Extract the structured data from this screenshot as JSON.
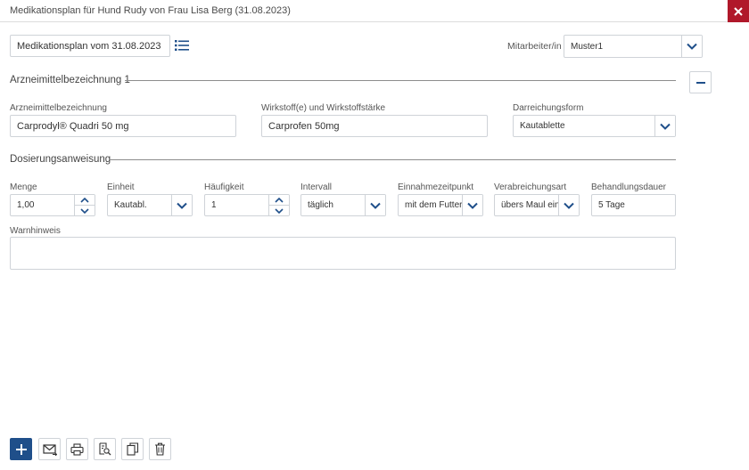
{
  "window": {
    "title": "Medikationsplan für Hund Rudy von Frau Lisa Berg (31.08.2023)"
  },
  "header": {
    "plan_name_value": "Medikationsplan vom 31.08.2023",
    "employee_label": "Mitarbeiter/in",
    "employee_value": "Muster1"
  },
  "medication": {
    "section_title": "Arzneimittelbezeichnung 1",
    "name_label": "Arzneimittelbezeichnung",
    "name_value": "Carprodyl® Quadri 50 mg",
    "ingredient_label": "Wirkstoff(e) und Wirkstoffstärke",
    "ingredient_value": "Carprofen 50mg",
    "form_label": "Darreichungsform",
    "form_value": "Kautablette"
  },
  "dosage": {
    "section_title": "Dosierungsanweisung",
    "amount_label": "Menge",
    "amount_value": "1,00",
    "unit_label": "Einheit",
    "unit_value": "Kautabl.",
    "frequency_label": "Häufigkeit",
    "frequency_value": "1",
    "interval_label": "Intervall",
    "interval_value": "täglich",
    "intake_time_label": "Einnahmezeitpunkt",
    "intake_time_value": "mit dem Futter",
    "route_label": "Verabreichungsart",
    "route_value": "übers Maul eing",
    "duration_label": "Behandlungsdauer",
    "duration_value": "5 Tage",
    "warning_label": "Warnhinweis",
    "warning_value": ""
  },
  "colors": {
    "accent": "#1f4f8a",
    "close": "#b0182a",
    "border": "#cfd3d8"
  },
  "toolbar": {
    "icons": [
      "plus-icon",
      "email-icon",
      "print-icon",
      "preview-icon",
      "copy-icon",
      "trash-icon"
    ]
  }
}
